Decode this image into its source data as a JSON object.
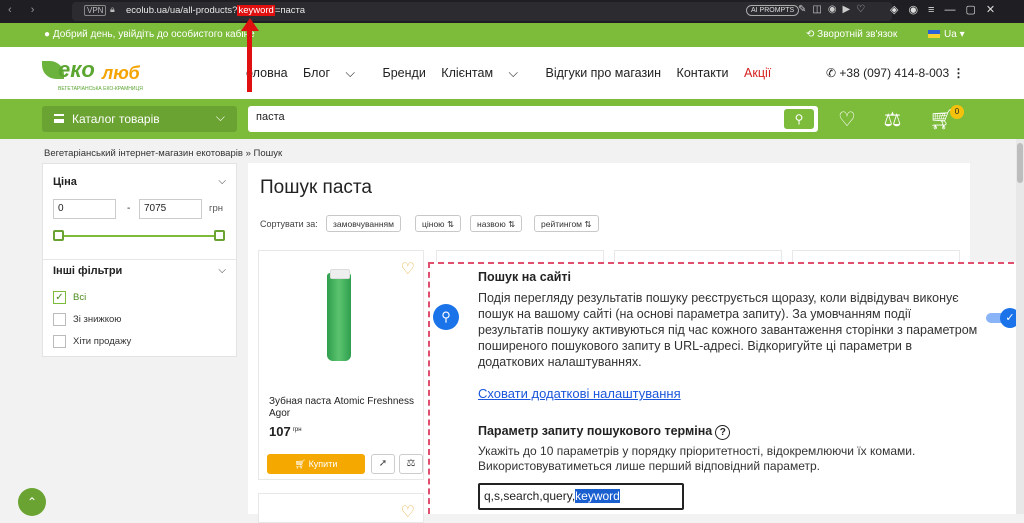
{
  "browser": {
    "vpn_label": "VPN",
    "url_before": "ecolub.ua/ua/all-products?",
    "url_highlight": "keyword",
    "url_after": "=паста",
    "ai_prompts_label": "AI PROMPTS"
  },
  "topbar": {
    "greeting": "Добрий день, увійдіть до особистого кабіне",
    "feedback": "Зворотній зв'язок",
    "language": "Ua"
  },
  "header": {
    "logo_eko": "еко",
    "logo_lub": "люб",
    "logo_tagline": "ВЕГЕТАРІАНСЬКА ЕКО-КРАМНИЦЯ",
    "menu": [
      "оловна",
      "Блог",
      "Бренди",
      "Клієнтам",
      "Відгуки про магазин",
      "Контакти",
      "Акції"
    ],
    "phone": "+38 (097) 414-8-003"
  },
  "searchbar": {
    "catalog_label": "Каталог товарів",
    "query": "паста",
    "cart_count": "0"
  },
  "breadcrumb": {
    "home": "Вегетаріанський інтернет-магазин екотоварів",
    "sep": "»",
    "current": "Пошук"
  },
  "filters": {
    "price_heading": "Ціна",
    "min_price": "0",
    "max_price": "7075",
    "dash": "-",
    "currency": "грн",
    "slider_range_fraction": [
      0.0,
      1.0
    ],
    "other_heading": "Інші фільтри",
    "options": [
      {
        "label": "Всі",
        "checked": true
      },
      {
        "label": "Зі знижкою",
        "checked": false
      },
      {
        "label": "Хіти продажу",
        "checked": false
      }
    ]
  },
  "main": {
    "title": "Пошук паста",
    "sort_label": "Сортувати за:",
    "sort_options": [
      "замовчуванням",
      "ціною",
      "назвою",
      "рейтингом"
    ]
  },
  "product": {
    "name": "Зубная паста Atomic Freshness Agor",
    "price": "107",
    "currency": "грн",
    "buy_label": "Купити"
  },
  "overlay": {
    "title": "Пошук на сайті",
    "description": "Подія перегляду результатів пошуку реєструється щоразу, коли відвідувач виконує пошук на вашому сайті (на основі параметра запиту). За умовчанням події результатів пошуку активуються під час кожного завантаження сторінки з параметром поширеного пошукового запиту в URL-адресі. Відкоригуйте ці параметри в додаткових налаштуваннях.",
    "toggle_on": true,
    "link": "Сховати додаткові налаштування",
    "param_heading": "Параметр запиту пошукового терміна",
    "param_hint": "Укажіть до 10 параметрів у порядку пріоритетності, відокремлюючи їх комами. Використовуватиметься лише перший відповідний параметр.",
    "param_value_plain": "q,s,search,query,",
    "param_value_selected": "keyword"
  },
  "colors": {
    "brand_green": "#7dbb3b",
    "accent_orange": "#f5a800",
    "google_blue": "#1a73e8",
    "annotation_red": "#e01010"
  }
}
